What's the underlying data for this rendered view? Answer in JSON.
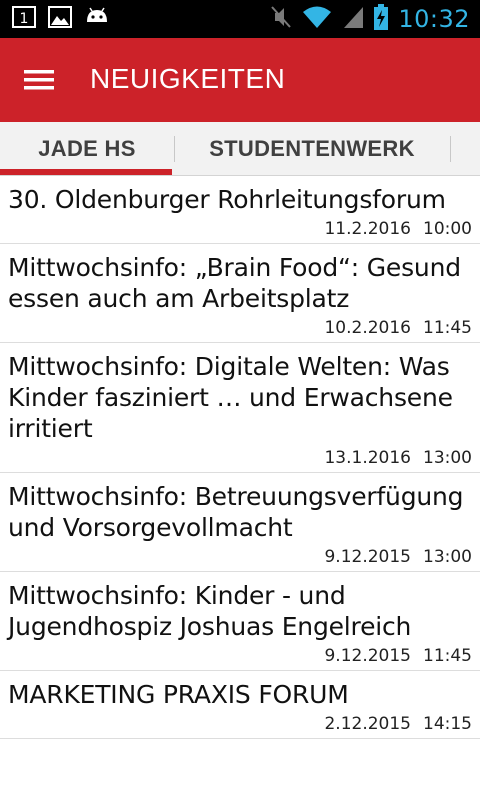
{
  "status_bar": {
    "time": "10:32",
    "notification_icons": [
      "sim-1-icon",
      "image-icon",
      "android-icon"
    ],
    "system_icons": [
      "mute-icon",
      "wifi-icon",
      "signal-icon",
      "battery-charging-icon"
    ]
  },
  "toolbar": {
    "title": "NEUIGKEITEN",
    "menu_icon": "hamburger-menu-icon"
  },
  "tabs": [
    {
      "label": "JADE HS",
      "selected": true
    },
    {
      "label": "STUDENTENWERK",
      "selected": false
    }
  ],
  "news": [
    {
      "title": "30. Oldenburger Rohrleitungsforum",
      "date": "11.2.2016",
      "time": "10:00"
    },
    {
      "title": "Mittwochsinfo: „Brain Food“: Gesund essen auch am Arbeitsplatz",
      "date": "10.2.2016",
      "time": "11:45"
    },
    {
      "title": "Mittwochsinfo: Digitale Welten: Was Kinder fasziniert … und Erwachsene irritiert",
      "date": "13.1.2016",
      "time": "13:00"
    },
    {
      "title": "Mittwochsinfo: Betreuungsverfügung und Vorsorgevollmacht",
      "date": "9.12.2015",
      "time": "13:00"
    },
    {
      "title": "Mittwochsinfo: Kinder - und Jugendhospiz Joshuas Engelreich",
      "date": "9.12.2015",
      "time": "11:45"
    },
    {
      "title": "MARKETING PRAXIS FORUM",
      "date": "2.12.2015",
      "time": "14:15"
    }
  ],
  "colors": {
    "accent": "#cc2229",
    "status_bar": "#000000",
    "clock": "#33b5e5"
  }
}
